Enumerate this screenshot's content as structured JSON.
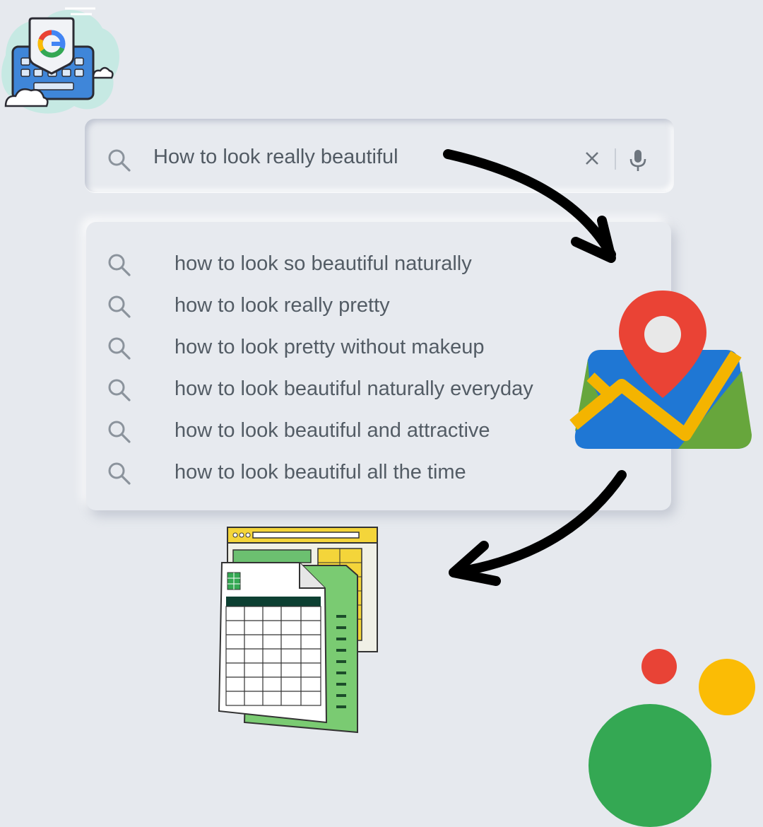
{
  "search": {
    "query": "How to look really beautiful",
    "icons": [
      "search-icon",
      "close-icon",
      "microphone-icon"
    ]
  },
  "suggestions": [
    "how to look so beautiful naturally",
    "how to look really pretty",
    "how to look pretty without makeup",
    "how to look beautiful naturally everyday",
    "how to look beautiful and attractive",
    "how to look beautiful all the time"
  ],
  "illustrations": [
    "google-keyboard-logo",
    "map-pin-icon",
    "spreadsheet-icon",
    "curved-arrow-icon"
  ],
  "colors": {
    "background": "#e6e9ee",
    "text": "#535c65",
    "red": "#e84336",
    "yellow": "#fbbc05",
    "green": "#34a853",
    "blue": "#1f77d4"
  }
}
